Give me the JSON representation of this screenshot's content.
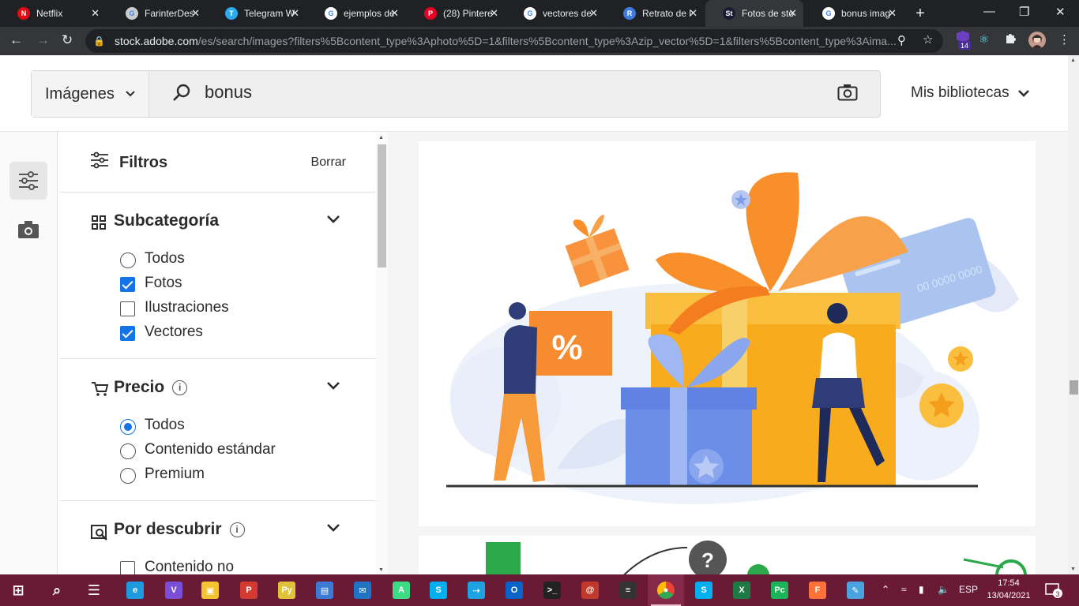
{
  "browser": {
    "tabs": [
      {
        "title": "Netflix",
        "icon": "netflix-icon",
        "color": "#e50914",
        "glyph": "N"
      },
      {
        "title": "FarinterDes",
        "icon": "github-icon",
        "color": "#cccccc",
        "glyph": "G"
      },
      {
        "title": "Telegram W",
        "icon": "telegram-icon",
        "color": "#2aabee",
        "glyph": "T"
      },
      {
        "title": "ejemplos de",
        "icon": "google-icon",
        "color": "#ffffff",
        "glyph": "G"
      },
      {
        "title": "(28) Pintere",
        "icon": "pinterest-icon",
        "color": "#e60023",
        "glyph": "P"
      },
      {
        "title": "vectores de",
        "icon": "google-icon",
        "color": "#ffffff",
        "glyph": "G"
      },
      {
        "title": "Retrato de l",
        "icon": "retrato-icon",
        "color": "#3d7be0",
        "glyph": "R"
      },
      {
        "title": "Fotos de sto",
        "icon": "adobe-stock-icon",
        "color": "#1b1b33",
        "glyph": "St"
      },
      {
        "title": "bonus imag",
        "icon": "google-icon",
        "color": "#ffffff",
        "glyph": "G"
      }
    ],
    "active_tab": 7,
    "new_tab": "+",
    "url_domain": "stock.adobe.com",
    "url_rest": "/es/search/images?filters%5Bcontent_type%3Aphoto%5D=1&filters%5Bcontent_type%3Azip_vector%5D=1&filters%5Bcontent_type%3Aima...",
    "ext_badge": "14"
  },
  "header": {
    "type_selector": "Imágenes",
    "search_query": "bonus",
    "libraries": "Mis bibliotecas"
  },
  "filters": {
    "title": "Filtros",
    "clear": "Borrar",
    "sections": [
      {
        "title": "Subcategoría",
        "icon": "grid-icon",
        "info": false,
        "control": "checkbox",
        "options": [
          {
            "label": "Todos",
            "checked": false,
            "control": "radio"
          },
          {
            "label": "Fotos",
            "checked": true,
            "control": "checkbox"
          },
          {
            "label": "Ilustraciones",
            "checked": false,
            "control": "checkbox"
          },
          {
            "label": "Vectores",
            "checked": true,
            "control": "checkbox"
          }
        ]
      },
      {
        "title": "Precio",
        "icon": "cart-icon",
        "info": true,
        "control": "radio",
        "options": [
          {
            "label": "Todos",
            "checked": true,
            "control": "radio"
          },
          {
            "label": "Contenido estándar",
            "checked": false,
            "control": "radio"
          },
          {
            "label": "Premium",
            "checked": false,
            "control": "radio"
          }
        ]
      },
      {
        "title": "Por descubrir",
        "icon": "discover-icon",
        "info": true,
        "control": "checkbox",
        "options": [
          {
            "label": "Contenido no",
            "checked": false,
            "control": "checkbox"
          }
        ]
      }
    ]
  },
  "result_card": {
    "card_text": "00 0000 0000"
  },
  "taskbar": {
    "apps": [
      "start-icon",
      "search-icon",
      "task-view-icon",
      "edge-icon",
      "visual-studio-icon",
      "file-explorer-icon",
      "pdf-icon",
      "python-icon",
      "store-icon",
      "mail-icon",
      "android-studio-icon",
      "skype-icon",
      "fiddler-icon",
      "outlook-icon",
      "terminal-icon",
      "app-icon",
      "git-icon",
      "chrome-icon",
      "skype-icon",
      "excel-icon",
      "pycharm-icon",
      "firefox-icon",
      "paint-icon"
    ],
    "language": "ESP",
    "time": "17:54",
    "date": "13/04/2021",
    "notifications": "3"
  },
  "colors": {
    "accent": "#1473e6",
    "taskbar": "#6b1a36",
    "chrome_dark": "#202124"
  }
}
